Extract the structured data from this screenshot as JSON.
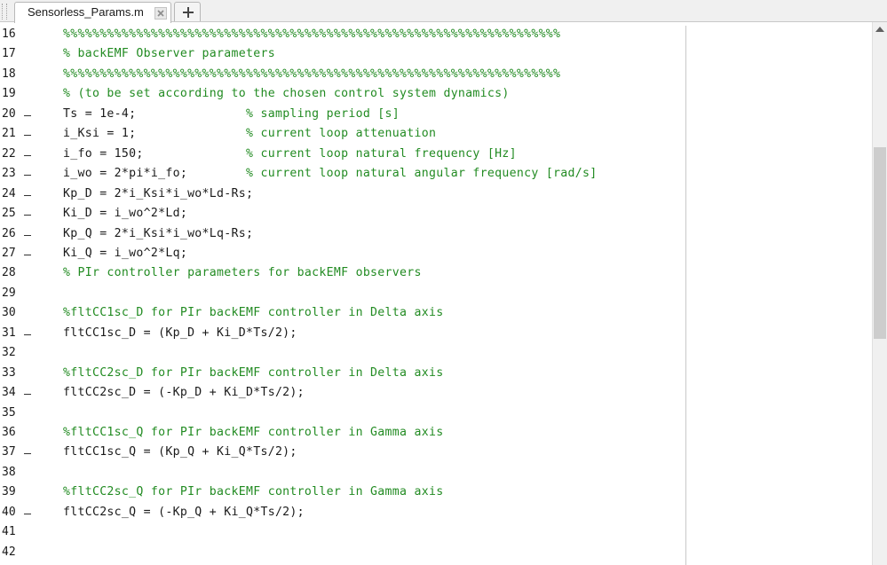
{
  "tabs": {
    "active_label": "Sensorless_Params.m",
    "close_icon": "close-icon",
    "add_icon": "plus-icon"
  },
  "colors": {
    "code": "#1a1a1a",
    "comment": "#228B22"
  },
  "lines": [
    {
      "num": "16",
      "marker": false,
      "code": "",
      "comment": "%%%%%%%%%%%%%%%%%%%%%%%%%%%%%%%%%%%%%%%%%%%%%%%%%%%%%%%%%%%%%%%%%%%%"
    },
    {
      "num": "17",
      "marker": false,
      "code": "",
      "comment": "% backEMF Observer parameters"
    },
    {
      "num": "18",
      "marker": false,
      "code": "",
      "comment": "%%%%%%%%%%%%%%%%%%%%%%%%%%%%%%%%%%%%%%%%%%%%%%%%%%%%%%%%%%%%%%%%%%%%"
    },
    {
      "num": "19",
      "marker": false,
      "code": "",
      "comment": "% (to be set according to the chosen control system dynamics)"
    },
    {
      "num": "20",
      "marker": true,
      "code": "Ts = 1e-4;               ",
      "comment": "% sampling period [s]"
    },
    {
      "num": "21",
      "marker": true,
      "code": "i_Ksi = 1;               ",
      "comment": "% current loop attenuation"
    },
    {
      "num": "22",
      "marker": true,
      "code": "i_fo = 150;              ",
      "comment": "% current loop natural frequency [Hz]"
    },
    {
      "num": "23",
      "marker": true,
      "code": "i_wo = 2*pi*i_fo;        ",
      "comment": "% current loop natural angular frequency [rad/s]"
    },
    {
      "num": "24",
      "marker": true,
      "code": "Kp_D = 2*i_Ksi*i_wo*Ld-Rs;",
      "comment": ""
    },
    {
      "num": "25",
      "marker": true,
      "code": "Ki_D = i_wo^2*Ld;",
      "comment": ""
    },
    {
      "num": "26",
      "marker": true,
      "code": "Kp_Q = 2*i_Ksi*i_wo*Lq-Rs;",
      "comment": ""
    },
    {
      "num": "27",
      "marker": true,
      "code": "Ki_Q = i_wo^2*Lq;",
      "comment": ""
    },
    {
      "num": "28",
      "marker": false,
      "code": "",
      "comment": "% PIr controller parameters for backEMF observers"
    },
    {
      "num": "29",
      "marker": false,
      "code": "",
      "comment": ""
    },
    {
      "num": "30",
      "marker": false,
      "code": "",
      "comment": "%fltCC1sc_D for PIr backEMF controller in Delta axis"
    },
    {
      "num": "31",
      "marker": true,
      "code": "fltCC1sc_D = (Kp_D + Ki_D*Ts/2);",
      "comment": ""
    },
    {
      "num": "32",
      "marker": false,
      "code": "",
      "comment": ""
    },
    {
      "num": "33",
      "marker": false,
      "code": "",
      "comment": "%fltCC2sc_D for PIr backEMF controller in Delta axis"
    },
    {
      "num": "34",
      "marker": true,
      "code": "fltCC2sc_D = (-Kp_D + Ki_D*Ts/2);",
      "comment": ""
    },
    {
      "num": "35",
      "marker": false,
      "code": "",
      "comment": ""
    },
    {
      "num": "36",
      "marker": false,
      "code": "",
      "comment": "%fltCC1sc_Q for PIr backEMF controller in Gamma axis"
    },
    {
      "num": "37",
      "marker": true,
      "code": "fltCC1sc_Q = (Kp_Q + Ki_Q*Ts/2);",
      "comment": ""
    },
    {
      "num": "38",
      "marker": false,
      "code": "",
      "comment": ""
    },
    {
      "num": "39",
      "marker": false,
      "code": "",
      "comment": "%fltCC2sc_Q for PIr backEMF controller in Gamma axis"
    },
    {
      "num": "40",
      "marker": true,
      "code": "fltCC2sc_Q = (-Kp_Q + Ki_Q*Ts/2);",
      "comment": ""
    },
    {
      "num": "41",
      "marker": false,
      "code": "",
      "comment": ""
    },
    {
      "num": "42",
      "marker": false,
      "code": "",
      "comment": ""
    }
  ]
}
